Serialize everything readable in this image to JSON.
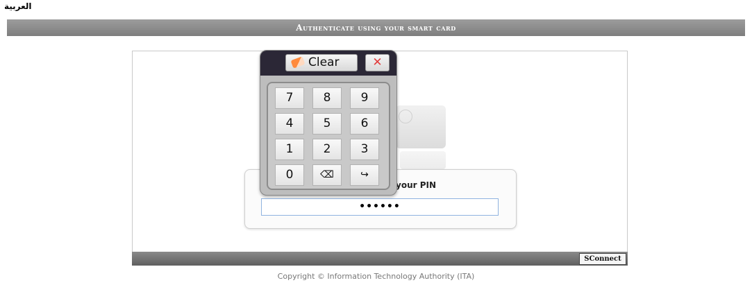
{
  "language_link": "العربية",
  "header": {
    "title": "Authenticate using your smart card"
  },
  "pin": {
    "label": "your PIN",
    "value": "••••••"
  },
  "keypad": {
    "clear_label": "Clear",
    "close_symbol": "✕",
    "keys": [
      "7",
      "8",
      "9",
      "4",
      "5",
      "6",
      "1",
      "2",
      "3",
      "0",
      "⌫",
      "↪"
    ]
  },
  "footer": {
    "logo_text": "SConnect",
    "copyright": "Copyright © Information Technology Authority (ITA)"
  }
}
